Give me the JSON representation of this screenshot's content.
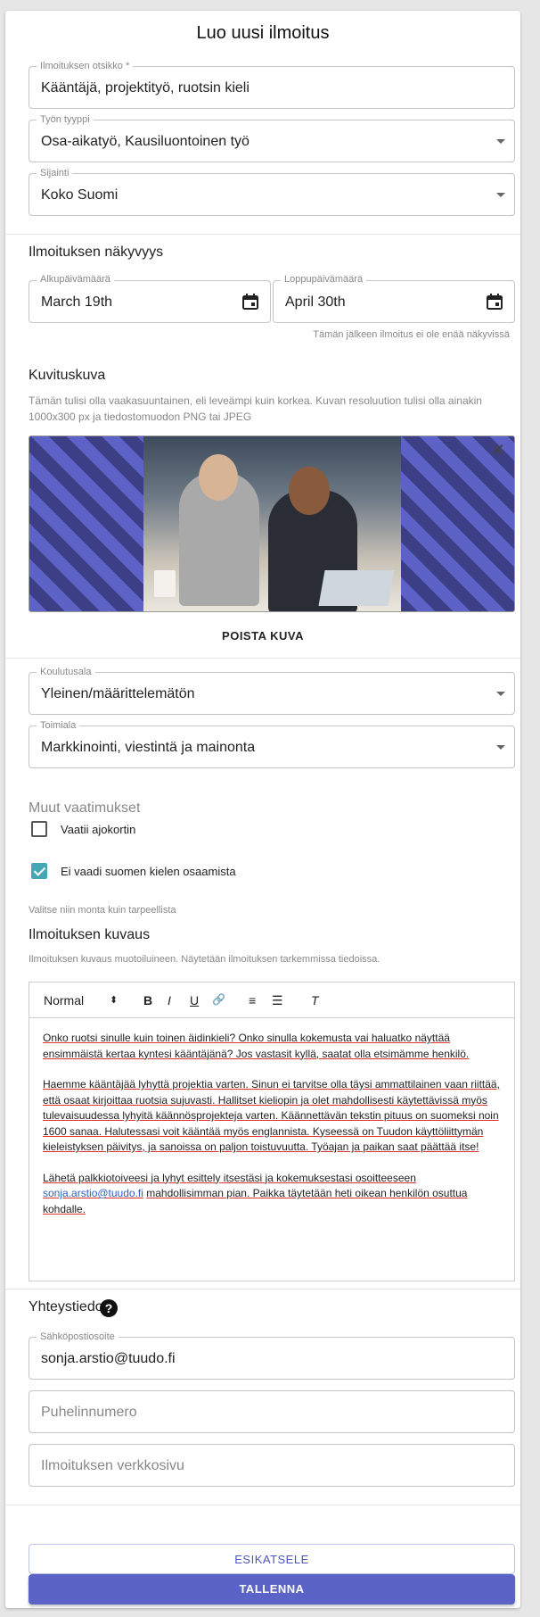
{
  "form": {
    "title": "Luo uusi ilmoitus",
    "fields": {
      "ad_title": {
        "label": "Ilmoituksen otsikko *",
        "value": "Kääntäjä, projektityö, ruotsin kieli"
      },
      "job_type": {
        "label": "Työn tyyppi",
        "value": "Osa-aikatyö, Kausiluontoinen työ"
      },
      "location": {
        "label": "Sijainti",
        "value": "Koko Suomi"
      }
    },
    "visibility": {
      "title": "Ilmoituksen näkyvyys",
      "start": {
        "label": "Alkupäivämäärä",
        "value": "March 19th"
      },
      "end": {
        "label": "Loppupäivämäärä",
        "value": "April 30th"
      },
      "end_help": "Tämän jälkeen ilmoitus ei ole enää näkyvissä"
    },
    "image": {
      "title": "Kuvituskuva",
      "help": "Tämän tulisi olla vaakasuuntainen, eli leveämpi kuin korkea. Kuvan resoluution tulisi olla ainakin 1000x300 px ja tiedostomuodon PNG tai JPEG",
      "remove_label": "POISTA KUVA",
      "close_glyph": "✕"
    },
    "education": {
      "label": "Koulutusala",
      "value": "Yleinen/määrittelemätön"
    },
    "industry": {
      "label": "Toimiala",
      "value": "Markkinointi, viestintä ja mainonta"
    },
    "requirements": {
      "title": "Muut vaatimukset",
      "options": [
        {
          "label": "Vaatii ajokortin",
          "checked": false
        },
        {
          "label": "Ei vaadi suomen kielen osaamista",
          "checked": true
        }
      ],
      "help": "Valitse niin monta kuin tarpeellista"
    },
    "description": {
      "title": "Ilmoituksen kuvaus",
      "help": "Ilmoituksen kuvaus muotoiluineen. Näytetään ilmoituksen tarkemmissa tiedoissa.",
      "toolbar": {
        "format": "Normal",
        "bold": "B",
        "italic": "I",
        "underline": "U",
        "link": "🔗",
        "ordered_list": "≡",
        "bullet_list": "☰",
        "clear": "T"
      },
      "paragraphs": [
        "Onko ruotsi sinulle kuin toinen äidinkieli? Onko sinulla kokemusta vai haluatko näyttää ensimmäistä kertaa kyntesi kääntäjänä? Jos vastasit kyllä, saatat olla etsimämme henkilö.",
        "Haemme kääntäjää lyhyttä projektia varten. Sinun ei tarvitse olla täysi ammattilainen vaan riittää, että osaat kirjoittaa ruotsia sujuvasti. Hallitset kieliopin ja olet mahdollisesti käytettävissä myös tulevaisuudessa lyhyitä käännösprojekteja varten. Käännettävän tekstin pituus on suomeksi noin 1600 sanaa. Halutessasi voit kääntää myös englannista. Kyseessä on Tuudon käyttöliittymän kieleistyksen päivitys, ja sanoissa on paljon toistuvuutta. Työajan ja paikan saat päättää itse!"
      ],
      "last": {
        "before": "Lähetä palkkiotoiveesi ja lyhyt esittely itsestäsi ja kokemuksestasi osoitteeseen",
        "email": "sonja.arstio@tuudo.fi",
        "after": "mahdollisimman pian. Paikka täytetään heti oikean henkilön osuttua kohdalle."
      }
    },
    "contact": {
      "title": "Yhteystiedot",
      "help_icon": "?",
      "email": {
        "label": "Sähköpostiosoite",
        "value": "sonja.arstio@tuudo.fi"
      },
      "phone": {
        "placeholder": "Puhelinnumero"
      },
      "website": {
        "placeholder": "Ilmoituksen verkkosivu"
      }
    },
    "buttons": {
      "preview": "ESIKATSELE",
      "save": "TALLENNA"
    },
    "colors": {
      "accent": "#5b64c6",
      "checkbox": "#46a6b5"
    }
  }
}
